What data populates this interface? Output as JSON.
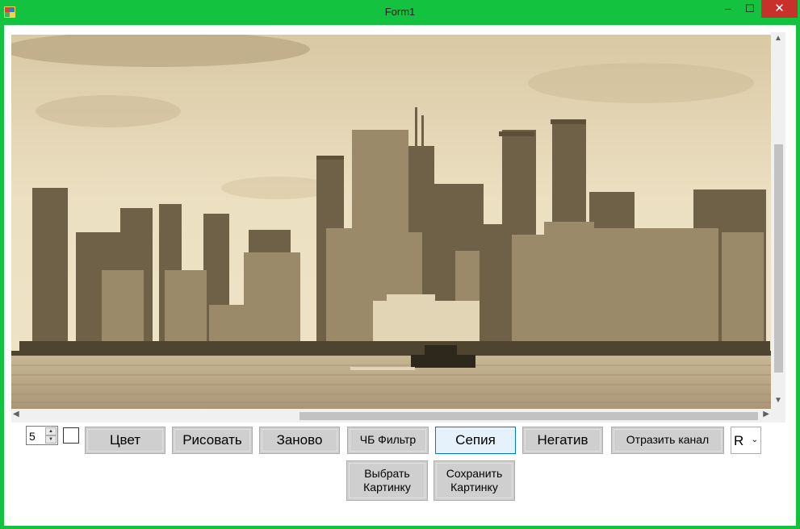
{
  "window": {
    "title": "Form1",
    "minimize_glyph": "–",
    "maximize_glyph": "☐",
    "close_glyph": "✕"
  },
  "scrollbar": {
    "up": "▲",
    "down": "▼",
    "left": "◀",
    "right": "▶"
  },
  "controls": {
    "brush_size": "5",
    "spin_up": "▲",
    "spin_down": "▼",
    "channel_select": "R",
    "channel_chevron": "⌄"
  },
  "buttons": {
    "color": "Цвет",
    "draw": "Рисовать",
    "reset": "Заново",
    "bw_filter": "ЧБ Фильтр",
    "sepia": "Сепия",
    "negative": "Негатив",
    "mirror_channel": "Отразить канал",
    "choose_picture": "Выбрать\nКартинку",
    "save_picture": "Сохранить\nКартинку"
  },
  "colors": {
    "window_border": "#13c23e",
    "close_button": "#c7302b",
    "sepia_sky": "#e9dcbd",
    "sepia_water": "#bfae8e",
    "selected_border": "#0078d7"
  }
}
